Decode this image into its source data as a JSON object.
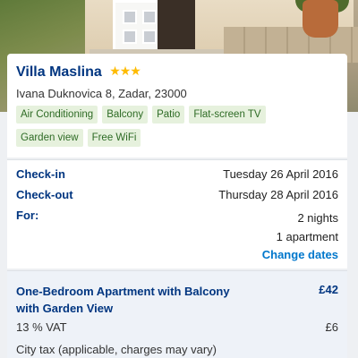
{
  "hotel": {
    "name": "Villa Maslina",
    "stars": "★★★",
    "address": "Ivana Duknovica 8, Zadar, 23000",
    "facilities": [
      "Air Conditioning",
      "Balcony",
      "Patio",
      "Flat-screen TV",
      "Garden view",
      "Free WiFi"
    ]
  },
  "booking": {
    "checkin_label": "Check-in",
    "checkin_value": "Tuesday 26 April 2016",
    "checkout_label": "Check-out",
    "checkout_value": "Thursday 28 April 2016",
    "for_label": "For:",
    "nights": "2 nights",
    "units": "1 apartment",
    "change_dates": "Change dates"
  },
  "room": {
    "title": "One-Bedroom Apartment with Balcony with Garden View",
    "price": "£42",
    "vat_label": "13 % VAT",
    "vat_price": "£6",
    "tax_note": "City tax (applicable, charges may vary)"
  },
  "colors": {
    "brand": "#003580",
    "link": "#0077cc",
    "star": "#febb02",
    "chip_bg": "#e6f1dd",
    "chip_text": "#2e6b25"
  }
}
